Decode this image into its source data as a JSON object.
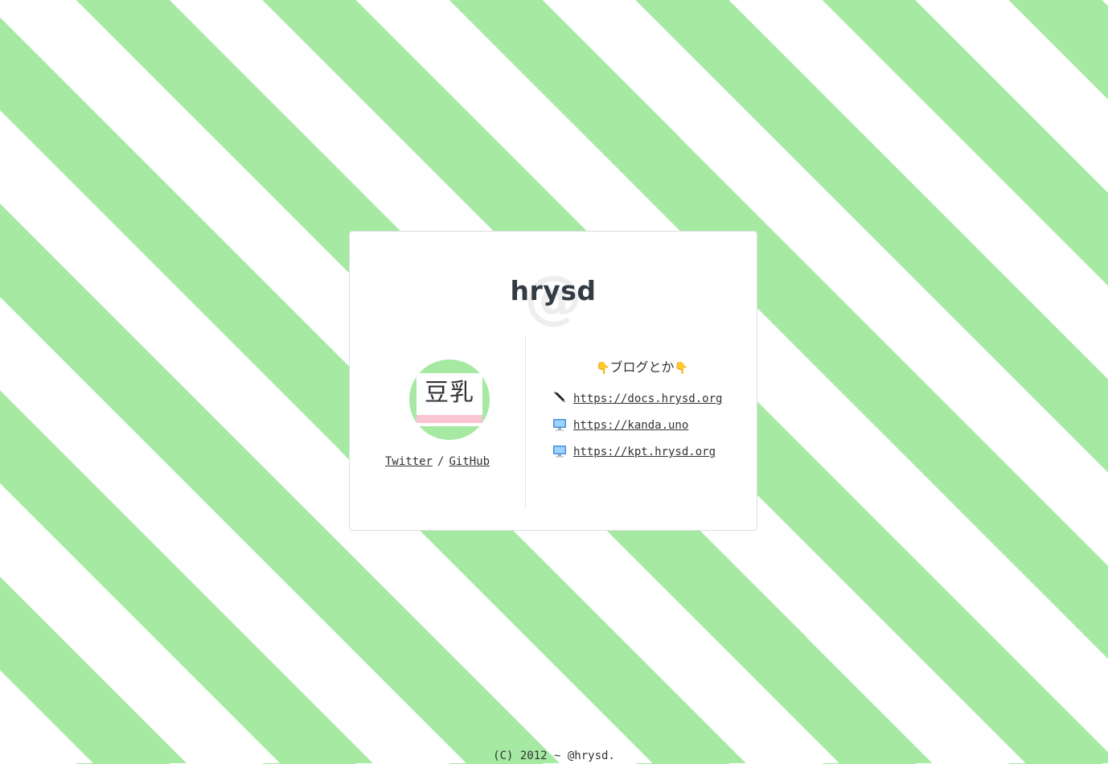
{
  "profile": {
    "title": "hrysd",
    "title_decoration": "@",
    "avatar_text": "豆乳"
  },
  "social": {
    "twitter_label": "Twitter",
    "separator": "/",
    "github_label": "GitHub"
  },
  "blog": {
    "heading_left_icon": "👇",
    "heading": "ブログとか",
    "heading_right_icon": "👇",
    "links": [
      {
        "icon": "pen-icon",
        "url": "https://docs.hrysd.org"
      },
      {
        "icon": "computer-icon",
        "url": "https://kanda.uno"
      },
      {
        "icon": "computer-icon",
        "url": "https://kpt.hrysd.org"
      }
    ]
  },
  "footer": {
    "copyright": "(C) 2012 ~ @hrysd."
  },
  "colors": {
    "stripe_green": "#a5e9a3",
    "avatar_bar_pink": "#f9c4d3",
    "hand_yellow": "#f4c223"
  }
}
